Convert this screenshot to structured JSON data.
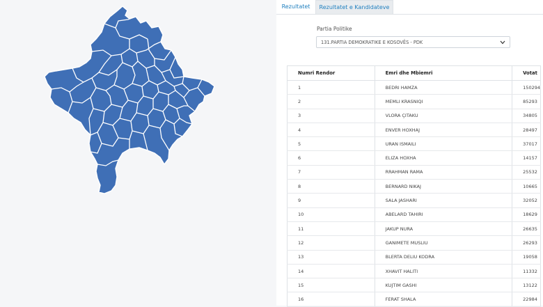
{
  "tabs": [
    {
      "label": "Rezultatet"
    },
    {
      "label": "Rezultatet e Kandidateve"
    }
  ],
  "filter": {
    "label": "Partia Politike",
    "selected": "131.PARTIA DEMOKRATIKE E KOSOVËS - PDK"
  },
  "table": {
    "headers": [
      "Numri Rendor",
      "Emri dhe Mbiemri",
      "Votat"
    ],
    "rows": [
      [
        "1",
        "BEDRI HAMZA",
        "150294"
      ],
      [
        "2",
        "MEMLI KRASNIQI",
        "85293"
      ],
      [
        "3",
        "VLORA ÇITAKU",
        "34805"
      ],
      [
        "4",
        "ENVER HOXHAJ",
        "28497"
      ],
      [
        "5",
        "URAN ISMAILI",
        "37017"
      ],
      [
        "6",
        "ELIZA HOXHA",
        "14157"
      ],
      [
        "7",
        "RRAHMAN RAMA",
        "25532"
      ],
      [
        "8",
        "BERNARD NIKAJ",
        "10665"
      ],
      [
        "9",
        "SALA JASHARI",
        "32052"
      ],
      [
        "10",
        "ABELARD TAHIRI",
        "18629"
      ],
      [
        "11",
        "JAKUP NURA",
        "26635"
      ],
      [
        "12",
        "GANIMETE MUSLIU",
        "26293"
      ],
      [
        "13",
        "BLERTA DELIU KODRA",
        "19058"
      ],
      [
        "14",
        "XHAVIT HALITI",
        "11332"
      ],
      [
        "15",
        "KUJTIM GASHI",
        "13122"
      ],
      [
        "16",
        "FERAT SHALA",
        "22984"
      ]
    ]
  },
  "colors": {
    "map_fill": "#3f6fb6",
    "map_border": "#ffffff",
    "accent": "#1f7fbf"
  }
}
